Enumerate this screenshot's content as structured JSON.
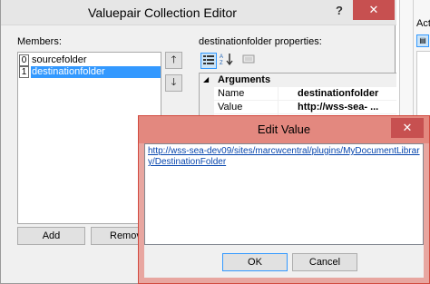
{
  "editor": {
    "title": "Valuepair Collection Editor",
    "help_label": "?",
    "close_label": "✕",
    "members_label": "Members:",
    "members": [
      {
        "index": "0",
        "name": "sourcefolder"
      },
      {
        "index": "1",
        "name": "destinationfolder"
      }
    ],
    "move_up_label": "🡑",
    "move_down_label": "🡓",
    "properties_label": "destinationfolder properties:",
    "toolbar": {
      "categorized_icon": "categorized-icon",
      "alphabetical_icon": "alphabetical-icon",
      "property_pages_icon": "property-pages-icon"
    },
    "grid": {
      "category": "Arguments",
      "rows": [
        {
          "name": "Name",
          "value": "destinationfolder"
        },
        {
          "name": "Value",
          "value": "http://wss-sea- ..."
        }
      ]
    },
    "add_label": "Add",
    "remove_label": "Remove"
  },
  "side_window": {
    "act_label": "Acti"
  },
  "dialog": {
    "title": "Edit Value",
    "close_label": "✕",
    "value": "http://wss-sea-dev09/sites/marcwcentral/plugins/MyDocumentLibrary/DestinationFolder",
    "ok_label": "OK",
    "cancel_label": "Cancel"
  }
}
